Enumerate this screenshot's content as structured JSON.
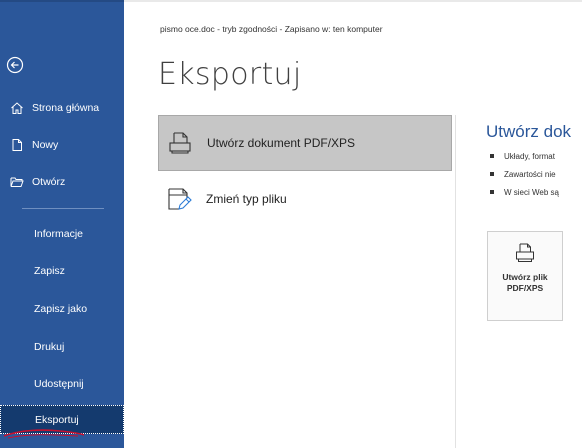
{
  "titlebar": {
    "text": "pismo oce.doc  -  tryb zgodności  -  Zapisano w: ten komputer"
  },
  "sidebar": {
    "top_items": [
      {
        "label": "Strona główna",
        "icon": "home-icon"
      },
      {
        "label": "Nowy",
        "icon": "new-document-icon"
      },
      {
        "label": "Otwórz",
        "icon": "folder-open-icon"
      }
    ],
    "items": [
      {
        "label": "Informacje"
      },
      {
        "label": "Zapisz"
      },
      {
        "label": "Zapisz jako"
      },
      {
        "label": "Drukuj"
      },
      {
        "label": "Udostępnij"
      },
      {
        "label": "Eksportuj",
        "active": true
      }
    ]
  },
  "main": {
    "title": "Eksportuj",
    "options": [
      {
        "label": "Utwórz dokument PDF/XPS",
        "icon": "pdf-document-icon",
        "selected": true
      },
      {
        "label": "Zmień typ pliku",
        "icon": "change-file-type-icon",
        "selected": false
      }
    ]
  },
  "detail": {
    "title": "Utwórz dok",
    "bullets": [
      "Układy, format",
      "Zawartości nie",
      "W sieci Web są"
    ],
    "button_label": "Utwórz plik PDF/XPS",
    "button_icon": "pdf-document-icon"
  },
  "colors": {
    "sidebar": "#2b579a",
    "sidebar_active": "#143a6e",
    "accent": "#2b579a",
    "selected_option": "#c6c6c6",
    "annotation_red": "#c8102e"
  }
}
